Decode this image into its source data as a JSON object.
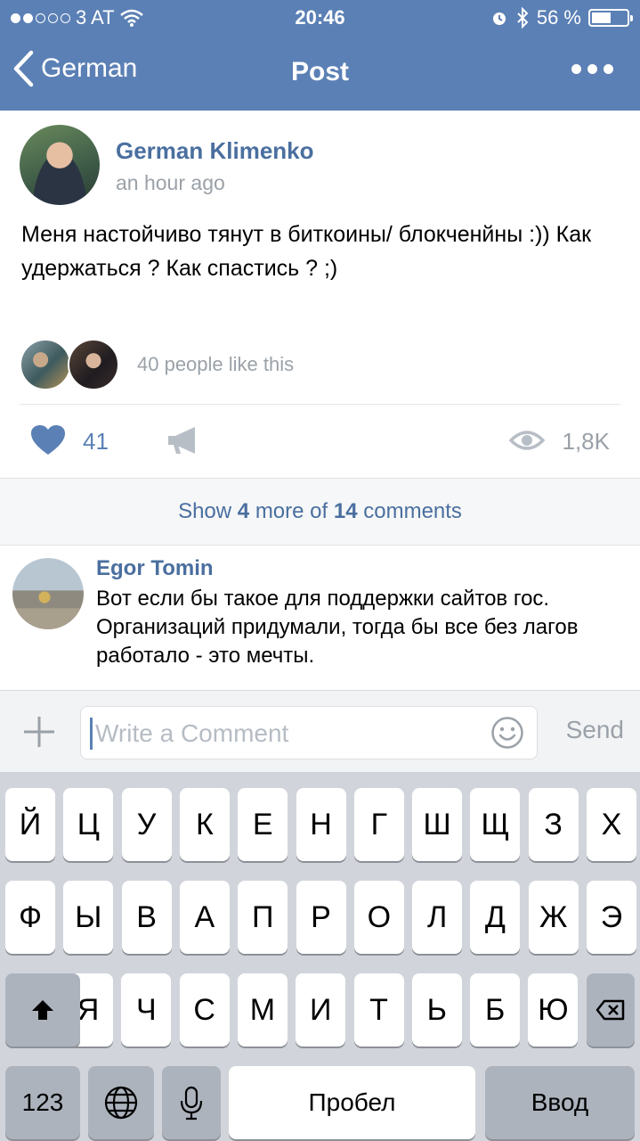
{
  "status_bar": {
    "carrier": "3 AT",
    "time": "20:46",
    "battery": "56 %",
    "battery_level": 0.56,
    "signal_bars_filled": 2
  },
  "nav": {
    "back_label": "German",
    "title": "Post"
  },
  "post": {
    "author": "German Klimenko",
    "time_ago": "an hour ago",
    "text": "Меня настойчиво тянут в биткоины/ блокченйны :)) Как удержаться ? Как спастись ? ;)",
    "likes_text": "40 people like this",
    "like_count": "41",
    "views": "1,8K"
  },
  "show_more": {
    "prefix": "Show",
    "count": "4",
    "middle": "more of",
    "total": "14",
    "suffix": "comments"
  },
  "comment": {
    "author": "Egor Tomin",
    "text": "Вот если бы такое для поддержки сайтов гос. Организаций придумали, тогда бы все без лагов работало - это мечты."
  },
  "compose": {
    "placeholder": "Write a Comment",
    "send_label": "Send"
  },
  "keyboard": {
    "row1": [
      "Й",
      "Ц",
      "У",
      "К",
      "Е",
      "Н",
      "Г",
      "Ш",
      "Щ",
      "З",
      "Х"
    ],
    "row2": [
      "Ф",
      "Ы",
      "В",
      "А",
      "П",
      "Р",
      "О",
      "Л",
      "Д",
      "Ж",
      "Э"
    ],
    "row3": [
      "Я",
      "Ч",
      "С",
      "М",
      "И",
      "Т",
      "Ь",
      "Б",
      "Ю"
    ],
    "numbers_label": "123",
    "space_label": "Пробел",
    "return_label": "Ввод"
  },
  "colors": {
    "brand": "#5b80b5",
    "link": "#4a6f9f",
    "muted": "#9aa1a8"
  }
}
